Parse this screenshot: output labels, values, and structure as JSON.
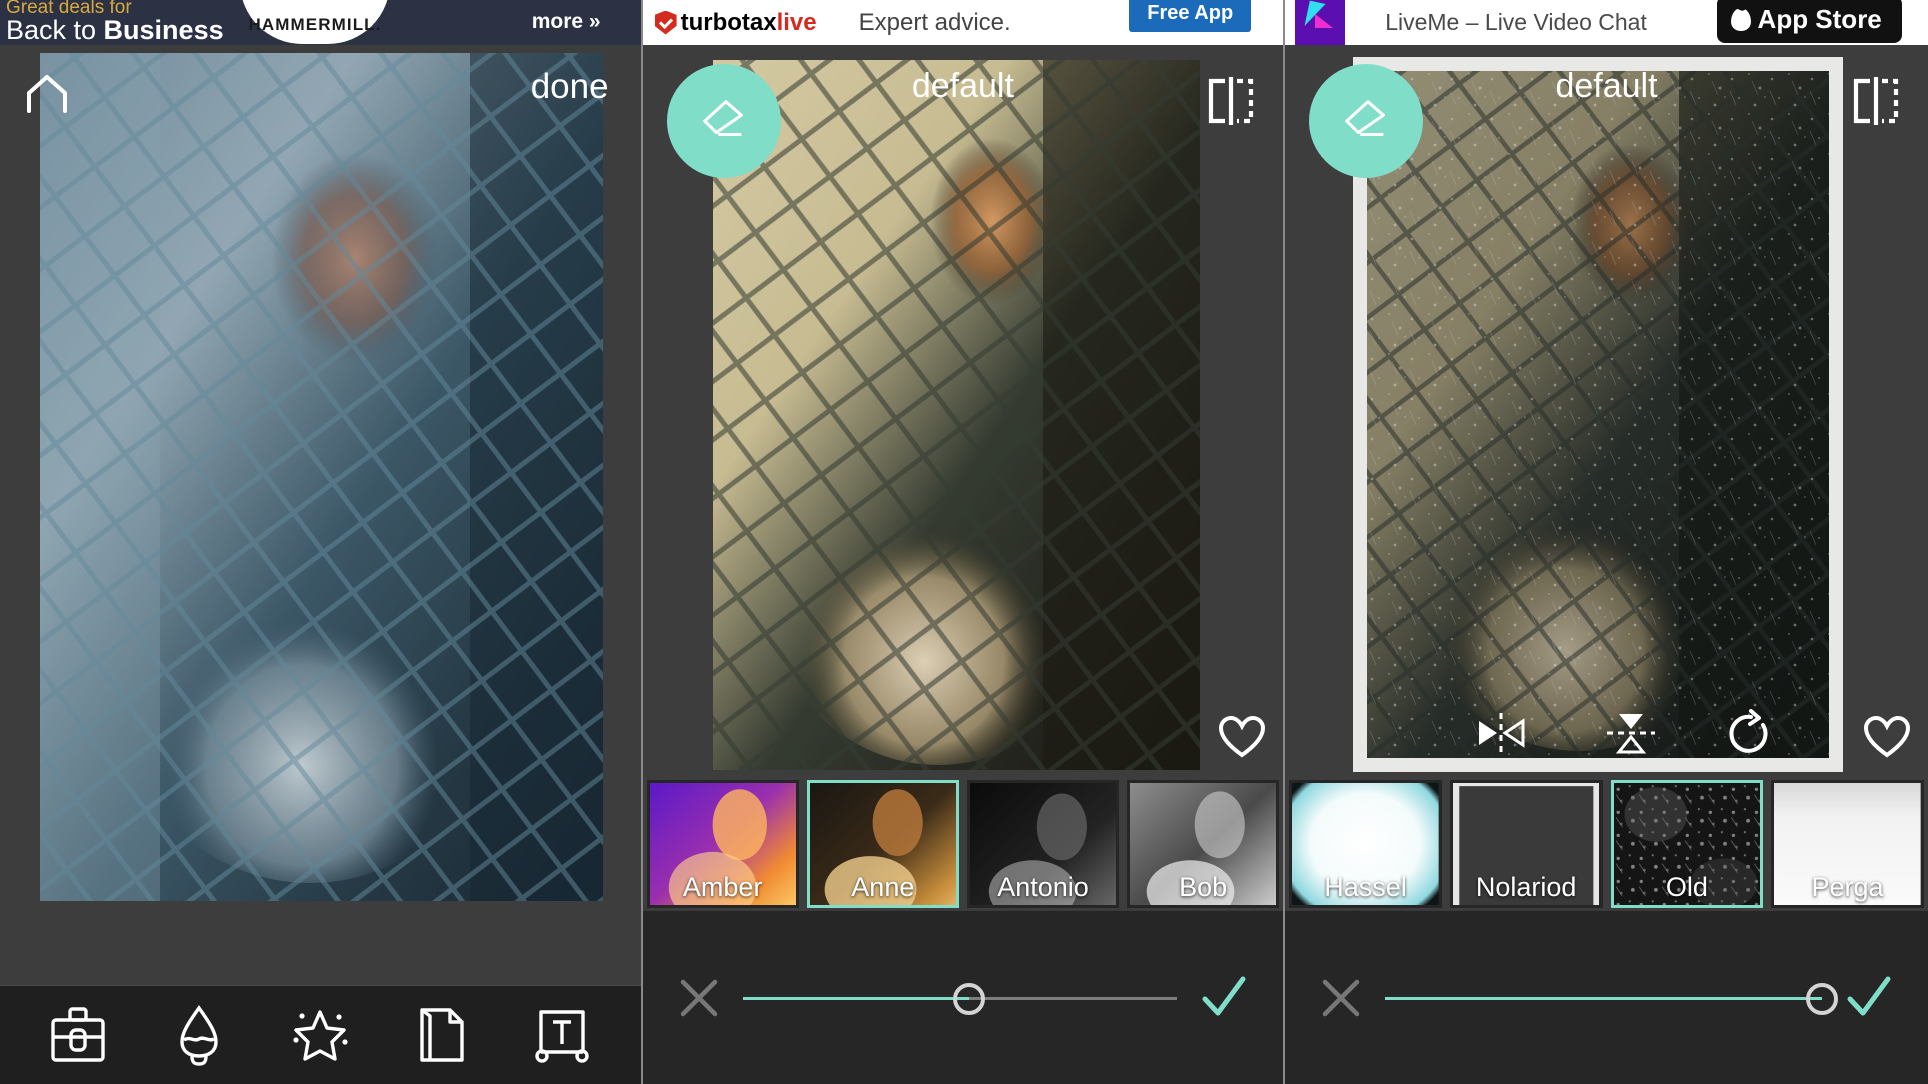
{
  "app": {
    "name": "photo-editor",
    "accent_color": "#7fddc8",
    "panel_bg": "#3d3d3d",
    "toolbar_bg": "#1f1f1f"
  },
  "ads": {
    "hammermill": {
      "line1": "Great deals for",
      "line2_plain": "Back to ",
      "line2_bold": "Business",
      "brand": "HAMMERMILL.",
      "more_label": "more »",
      "bg_color": "#2c3244",
      "accent_color": "#d8a93e"
    },
    "turbotax": {
      "brand_plain": "turbotax",
      "brand_accent": "live",
      "tagline": "Expert advice.",
      "cta_label": "Free App",
      "cta_color": "#1c6bba"
    },
    "liveme": {
      "title": "LiveMe – Live Video Chat",
      "cta_label": "App Store"
    }
  },
  "panel1": {
    "home_icon": "home-icon",
    "done_label": "done",
    "photo_alt": "man behind chain-link fence",
    "toolbar": [
      {
        "name": "toolbox-icon",
        "label": "Tools"
      },
      {
        "name": "brush-icon",
        "label": "Brush"
      },
      {
        "name": "magic-star-icon",
        "label": "Effects"
      },
      {
        "name": "page-icon",
        "label": "Overlay"
      },
      {
        "name": "text-icon",
        "label": "Text"
      }
    ]
  },
  "panel2": {
    "eraser_icon": "eraser-icon",
    "preset_title": "default",
    "compare_icon": "compare-icon",
    "favorite_icon": "heart-icon",
    "thumbnails": [
      {
        "label": "Amber",
        "selected": false
      },
      {
        "label": "Anne",
        "selected": true
      },
      {
        "label": "Antonio",
        "selected": false
      },
      {
        "label": "Bob",
        "selected": false
      }
    ],
    "slider": {
      "cancel_icon": "close-icon",
      "confirm_icon": "check-icon",
      "value_percent": 52
    }
  },
  "panel3": {
    "eraser_icon": "eraser-icon",
    "preset_title": "default",
    "compare_icon": "compare-icon",
    "favorite_icon": "heart-icon",
    "transform_tools": [
      {
        "name": "flip-horizontal-icon"
      },
      {
        "name": "flip-vertical-icon"
      },
      {
        "name": "rotate-icon"
      }
    ],
    "thumbnails": [
      {
        "label": "Hassel",
        "selected": false
      },
      {
        "label": "Nolariod",
        "selected": false
      },
      {
        "label": "Old",
        "selected": true
      },
      {
        "label": "Perga",
        "selected": false
      }
    ],
    "slider": {
      "cancel_icon": "close-icon",
      "confirm_icon": "check-icon",
      "value_percent": 100
    }
  }
}
